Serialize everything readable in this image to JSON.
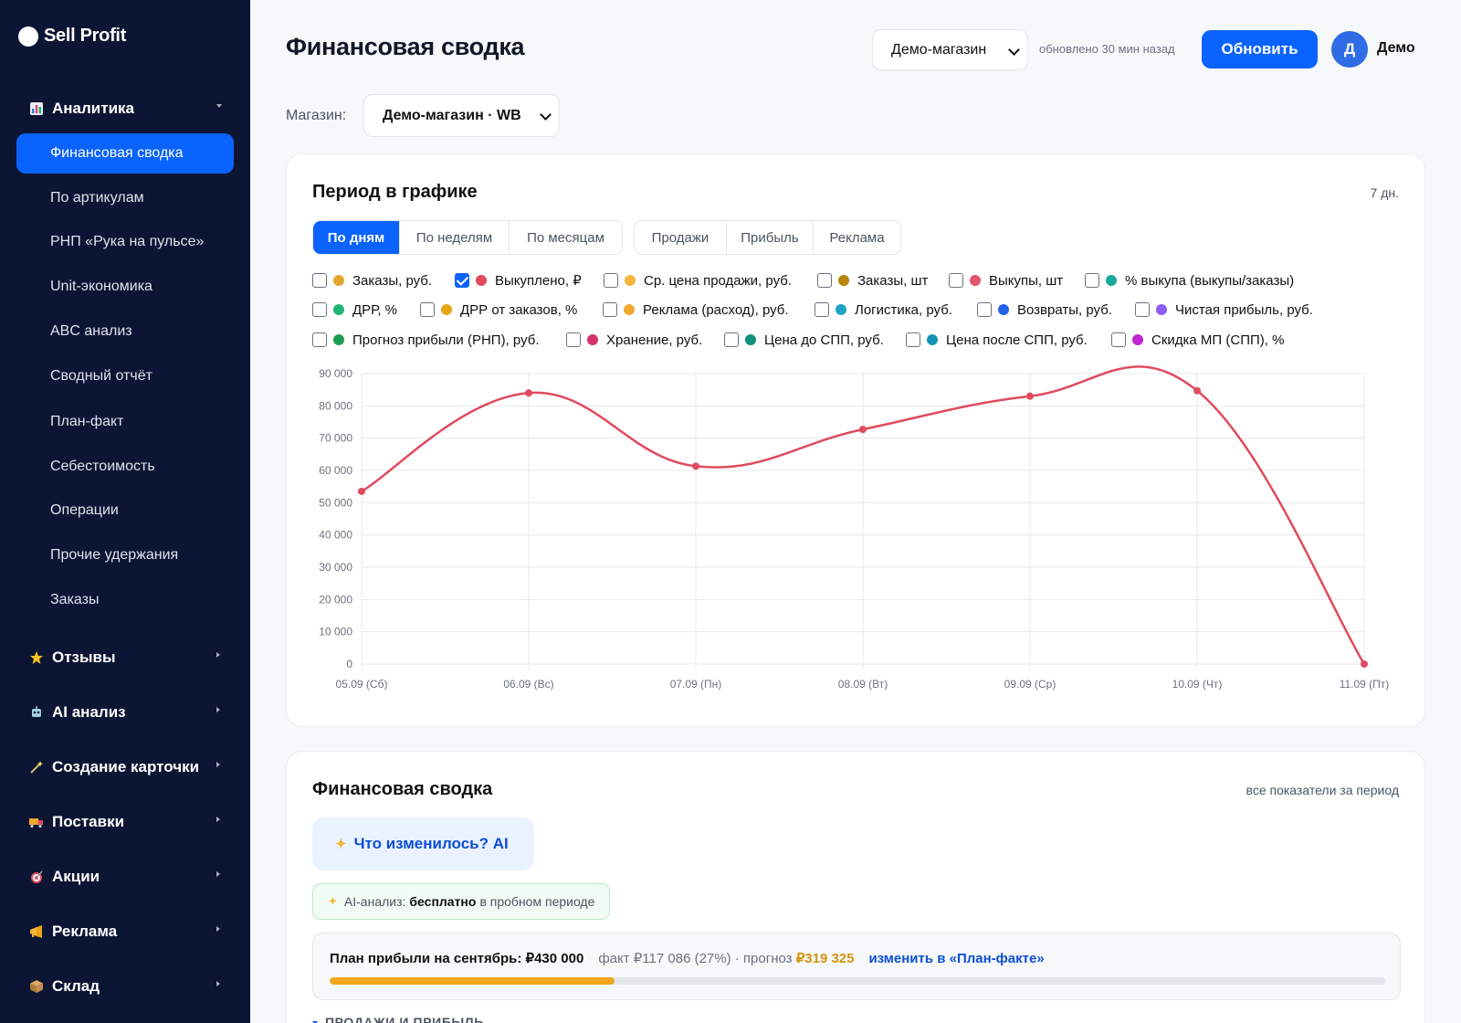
{
  "sidebar": {
    "brand": "Sell Profit",
    "groups": [
      {
        "label": "Аналитика",
        "icon": "bar-chart-icon"
      },
      {
        "label": "Отзывы",
        "icon": "star-icon"
      },
      {
        "label": "AI анализ",
        "icon": "robot-icon"
      },
      {
        "label": "Создание карточки",
        "icon": "magic-wand-icon"
      },
      {
        "label": "Поставки",
        "icon": "truck-icon"
      },
      {
        "label": "Акции",
        "icon": "target-icon"
      },
      {
        "label": "Реклама",
        "icon": "megaphone-icon"
      },
      {
        "label": "Склад",
        "icon": "box-icon"
      }
    ],
    "items": [
      {
        "label": "Финансовая сводка",
        "active": true
      },
      {
        "label": "По артикулам"
      },
      {
        "label": "РНП «Рука на пульсе»"
      },
      {
        "label": "Unit-экономика"
      },
      {
        "label": "ABC анализ"
      },
      {
        "label": "Сводный отчёт"
      },
      {
        "label": "План-факт"
      },
      {
        "label": "Себестоимость"
      },
      {
        "label": "Операции"
      },
      {
        "label": "Прочие удержания"
      },
      {
        "label": "Заказы"
      }
    ]
  },
  "header": {
    "title": "Финансовая сводка",
    "store_select": "Демо-магазин",
    "updated": "обновлено 30 мин назад",
    "refresh_label": "Обновить",
    "avatar_letter": "Д",
    "user_name": "Демо"
  },
  "shop": {
    "label": "Магазин:",
    "value": "Демо-магазин · WB"
  },
  "chart_card": {
    "title": "Период в графике",
    "days": "7 дн.",
    "period_tabs": [
      {
        "label": "По дням",
        "active": true
      },
      {
        "label": "По неделям"
      },
      {
        "label": "По месяцам"
      }
    ],
    "metric_tabs": [
      {
        "label": "Продажи"
      },
      {
        "label": "Прибыль"
      },
      {
        "label": "Реклама"
      }
    ],
    "legend": [
      {
        "label": "Заказы, руб.",
        "color": "#e3a72f",
        "checked": false
      },
      {
        "label": "Выкуплено, ₽",
        "color": "#e04b5f",
        "checked": true
      },
      {
        "label": "Ср. цена продажи, руб.",
        "color": "#f2b53a",
        "checked": false
      },
      {
        "label": "Заказы, шт",
        "color": "#b8860b",
        "checked": false
      },
      {
        "label": "Выкупы, шт",
        "color": "#e0566b",
        "checked": false
      },
      {
        "label": "% выкупа (выкупы/заказы)",
        "color": "#1aa89b",
        "checked": false
      },
      {
        "label": "ДРР, %",
        "color": "#22b573",
        "checked": false
      },
      {
        "label": "ДРР от заказов, %",
        "color": "#e8a317",
        "checked": false
      },
      {
        "label": "Реклама (расход), руб.",
        "color": "#f0a830",
        "checked": false
      },
      {
        "label": "Логистика, руб.",
        "color": "#1fa3c4",
        "checked": false
      },
      {
        "label": "Возвраты, руб.",
        "color": "#2563eb",
        "checked": false
      },
      {
        "label": "Чистая прибыль, руб.",
        "color": "#8b5cf6",
        "checked": false
      },
      {
        "label": "Прогноз прибыли (РНП), руб.",
        "color": "#1f9d55",
        "checked": false
      },
      {
        "label": "Хранение, руб.",
        "color": "#d6336c",
        "checked": false
      },
      {
        "label": "Цена до СПП, руб.",
        "color": "#0f8f7d",
        "checked": false
      },
      {
        "label": "Цена после СПП, руб.",
        "color": "#1694b8",
        "checked": false
      },
      {
        "label": "Скидка МП (СПП), %",
        "color": "#c026d3",
        "checked": false
      }
    ]
  },
  "chart_data": {
    "type": "line",
    "x": [
      "05.09 (Сб)",
      "06.09 (Вс)",
      "07.09 (Пн)",
      "08.09 (Вт)",
      "09.09 (Ср)",
      "10.09 (Чт)",
      "11.09 (Пт)"
    ],
    "series": [
      {
        "name": "Выкуплено, ₽",
        "color": "#e04b5f",
        "values": [
          53500,
          84000,
          61300,
          72700,
          83000,
          84700,
          0
        ]
      }
    ],
    "yticks": [
      "0",
      "10 000",
      "20 000",
      "30 000",
      "40 000",
      "50 000",
      "60 000",
      "70 000",
      "80 000",
      "90 000"
    ],
    "ylim": [
      0,
      90000
    ],
    "grid": true
  },
  "summary_card": {
    "title": "Финансовая сводка",
    "aside": "все показатели за период",
    "ai_button": "Что изменилось? AI",
    "ai_note_prefix": "AI-анализ:",
    "ai_note_bold": "бесплатно",
    "ai_note_suffix": "в пробном периоде",
    "plan_title": "План прибыли на сентябрь: ₽430 000",
    "plan_fact": "факт ₽117 086 (27%) · прогноз",
    "plan_forecast": "₽319 325",
    "plan_link": "изменить в «План-факте»",
    "plan_progress_percent": 27,
    "section_head": "ПРОДАЖИ И ПРИБЫЛЬ"
  }
}
